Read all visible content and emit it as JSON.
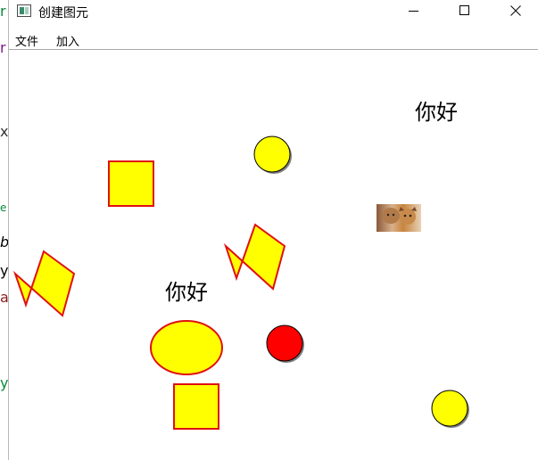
{
  "window": {
    "title": "创建图元"
  },
  "menubar": {
    "items": [
      "文件",
      "加入"
    ]
  },
  "canvas": {
    "text_items": [
      "你好",
      "你好"
    ],
    "colors": {
      "fill_yellow": "#ffff00",
      "stroke_red": "#e01010",
      "fill_red": "#ff0000",
      "shadow": "#808080"
    },
    "image_item": "cat-photo"
  }
}
